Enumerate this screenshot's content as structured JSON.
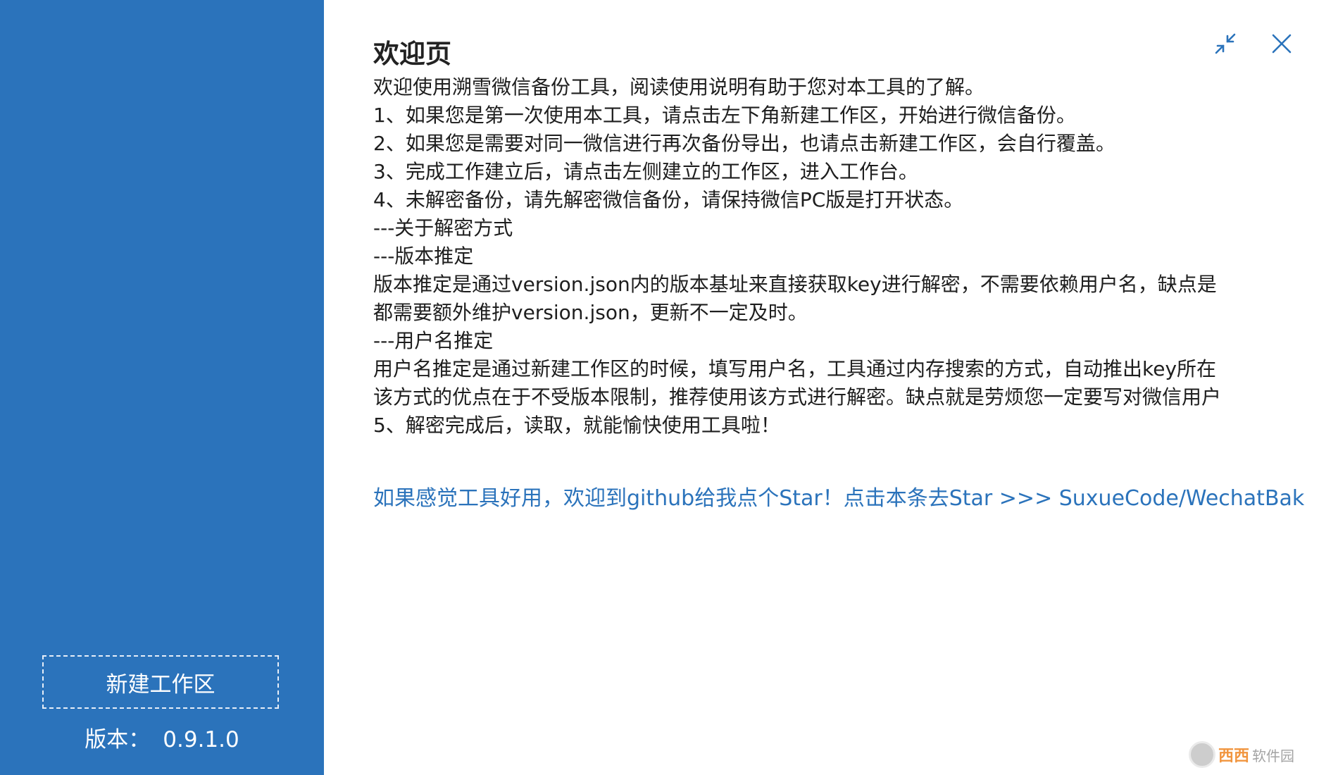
{
  "sidebar": {
    "new_workspace_label": "新建工作区",
    "version_label": "版本：",
    "version_value": "0.9.1.0"
  },
  "main": {
    "title": "欢迎页",
    "lines": [
      "欢迎使用溯雪微信备份工具，阅读使用说明有助于您对本工具的了解。",
      "1、如果您是第一次使用本工具，请点击左下角新建工作区，开始进行微信备份。",
      "2、如果您是需要对同一微信进行再次备份导出，也请点击新建工作区，会自行覆盖。",
      "3、完成工作建立后，请点击左侧建立的工作区，进入工作台。",
      "4、未解密备份，请先解密微信备份，请保持微信PC版是打开状态。",
      "---关于解密方式",
      "---版本推定",
      "版本推定是通过version.json内的版本基址来直接获取key进行解密，不需要依赖用户名，缺点是",
      "都需要额外维护version.json，更新不一定及时。",
      "---用户名推定",
      "用户名推定是通过新建工作区的时候，填写用户名，工具通过内存搜索的方式，自动推出key所在",
      "该方式的优点在于不受版本限制，推荐使用该方式进行解密。缺点就是劳烦您一定要写对微信用户",
      "5、解密完成后，读取，就能愉快使用工具啦！"
    ],
    "star_link": "如果感觉工具好用，欢迎到github给我点个Star！点击本条去Star >>> SuxueCode/WechatBak"
  },
  "watermark": {
    "brand": "西西",
    "sub": "软件园"
  },
  "colors": {
    "sidebar": "#2b73bb",
    "link": "#2b73bb",
    "text": "#1e1e1e"
  },
  "icons": {
    "minimize": "shrink-arrows-icon",
    "close": "close-icon"
  }
}
